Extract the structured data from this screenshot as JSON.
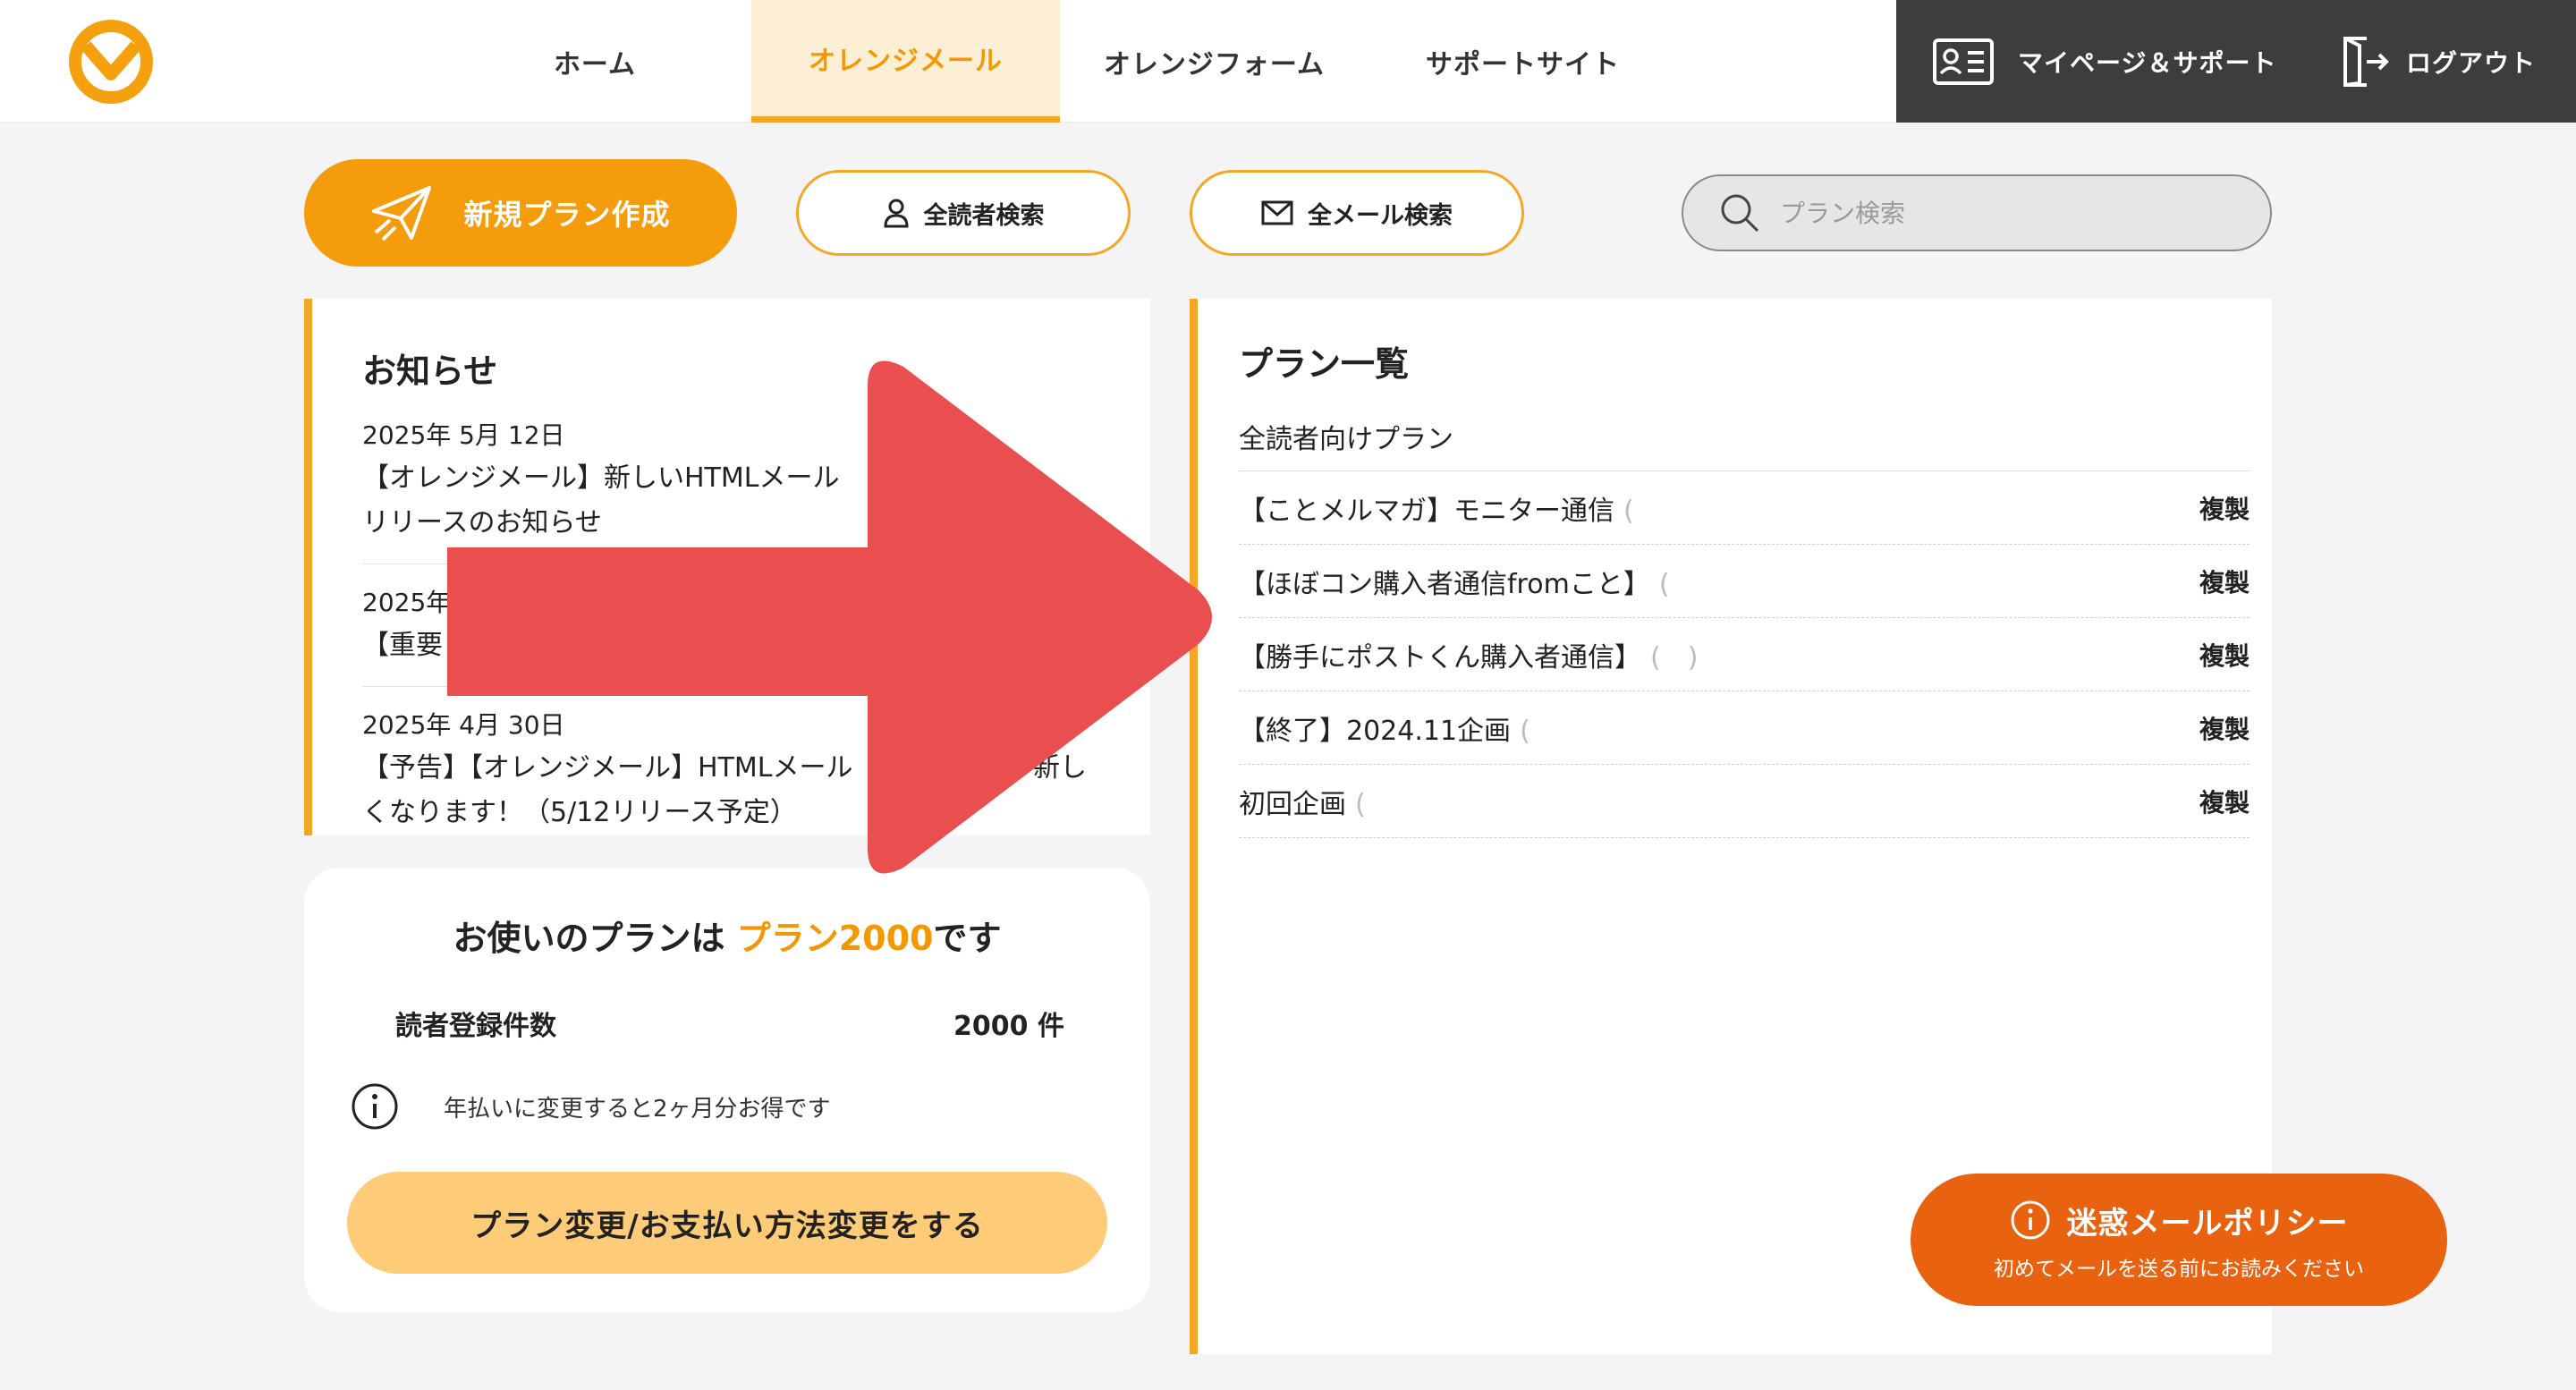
{
  "colors": {
    "brand_orange": "#f39800",
    "accent_orange": "#f5a623",
    "dark_bar": "#3d3d3d",
    "spam_orange": "#e8620f",
    "arrow_red": "#e94f4f"
  },
  "header": {
    "logo_icon": "orange-mail-logo-icon",
    "nav": [
      {
        "label": "ホーム",
        "active": false
      },
      {
        "label": "オレンジメール",
        "active": true
      },
      {
        "label": "オレンジフォーム",
        "active": false
      },
      {
        "label": "サポートサイト",
        "active": false
      }
    ],
    "mypage_label": "マイページ＆サポート",
    "logout_label": "ログアウト"
  },
  "actions": {
    "new_plan_label": "新規プラン作成",
    "search_readers_label": "全読者検索",
    "search_mails_label": "全メール検索",
    "plan_search_placeholder": "プラン検索"
  },
  "notices": {
    "title": "お知らせ",
    "items": [
      {
        "date": "2025年 5月 12日",
        "text_line1": "【オレンジメール】新しいHTMLメール",
        "text_line2": "リリースのお知らせ"
      },
      {
        "date": "2025年",
        "text_line1": "【重要",
        "text_line2": ""
      },
      {
        "date": "2025年 4月 30日",
        "text_line1": "【予告】【オレンジメール】HTMLメール",
        "text_line1_end": "新し",
        "text_line2": "くなります！（5/12リリース予定）"
      }
    ]
  },
  "plan_summary": {
    "heading_prefix": "お使いのプランは ",
    "plan_name": "プラン2000",
    "heading_suffix": "です",
    "reader_label": "読者登録件数",
    "reader_count": "2000 件",
    "info_text": "年払いに変更すると2ヶ月分お得です",
    "change_button_label": "プラン変更/お支払い方法変更をする"
  },
  "plan_list": {
    "title": "プラン一覧",
    "group_label": "全読者向けプラン",
    "copy_label": "複製",
    "plans": [
      {
        "name": "【ことメルマガ】モニター通信",
        "paren": "("
      },
      {
        "name": "【ほぼコン購入者通信fromこと】",
        "paren": "("
      },
      {
        "name": "【勝手にポストくん購入者通信】",
        "paren": "(　)"
      },
      {
        "name": "【終了】2024.11企画",
        "paren": "("
      },
      {
        "name": "初回企画",
        "paren": "("
      }
    ]
  },
  "spam_policy": {
    "title": "迷惑メールポリシー",
    "subtitle": "初めてメールを送る前にお読みください"
  }
}
